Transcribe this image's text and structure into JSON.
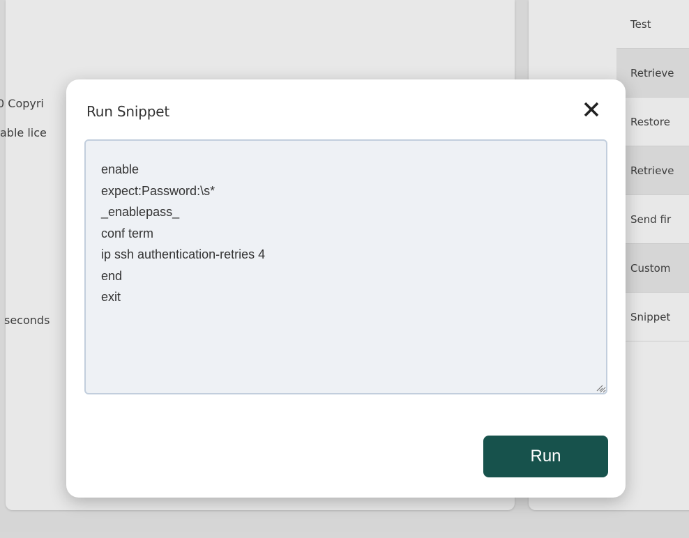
{
  "background": {
    "left_texts": [
      "0 Copyri",
      "able lice",
      "seconds"
    ],
    "menu_items": [
      "Test",
      "Retrieve",
      "Restore",
      "Retrieve",
      "Send fir",
      "Custom",
      "Snippet"
    ]
  },
  "modal": {
    "title": "Run Snippet",
    "close_icon": "close-icon",
    "snippet_text": "enable\nexpect:Password:\\s*\n_enablepass_\nconf term\nip ssh authentication-retries 4\nend\nexit",
    "run_label": "Run"
  },
  "colors": {
    "run_button": "#17524c",
    "textarea_bg": "#eef1f5",
    "textarea_border": "#c2cedd"
  }
}
